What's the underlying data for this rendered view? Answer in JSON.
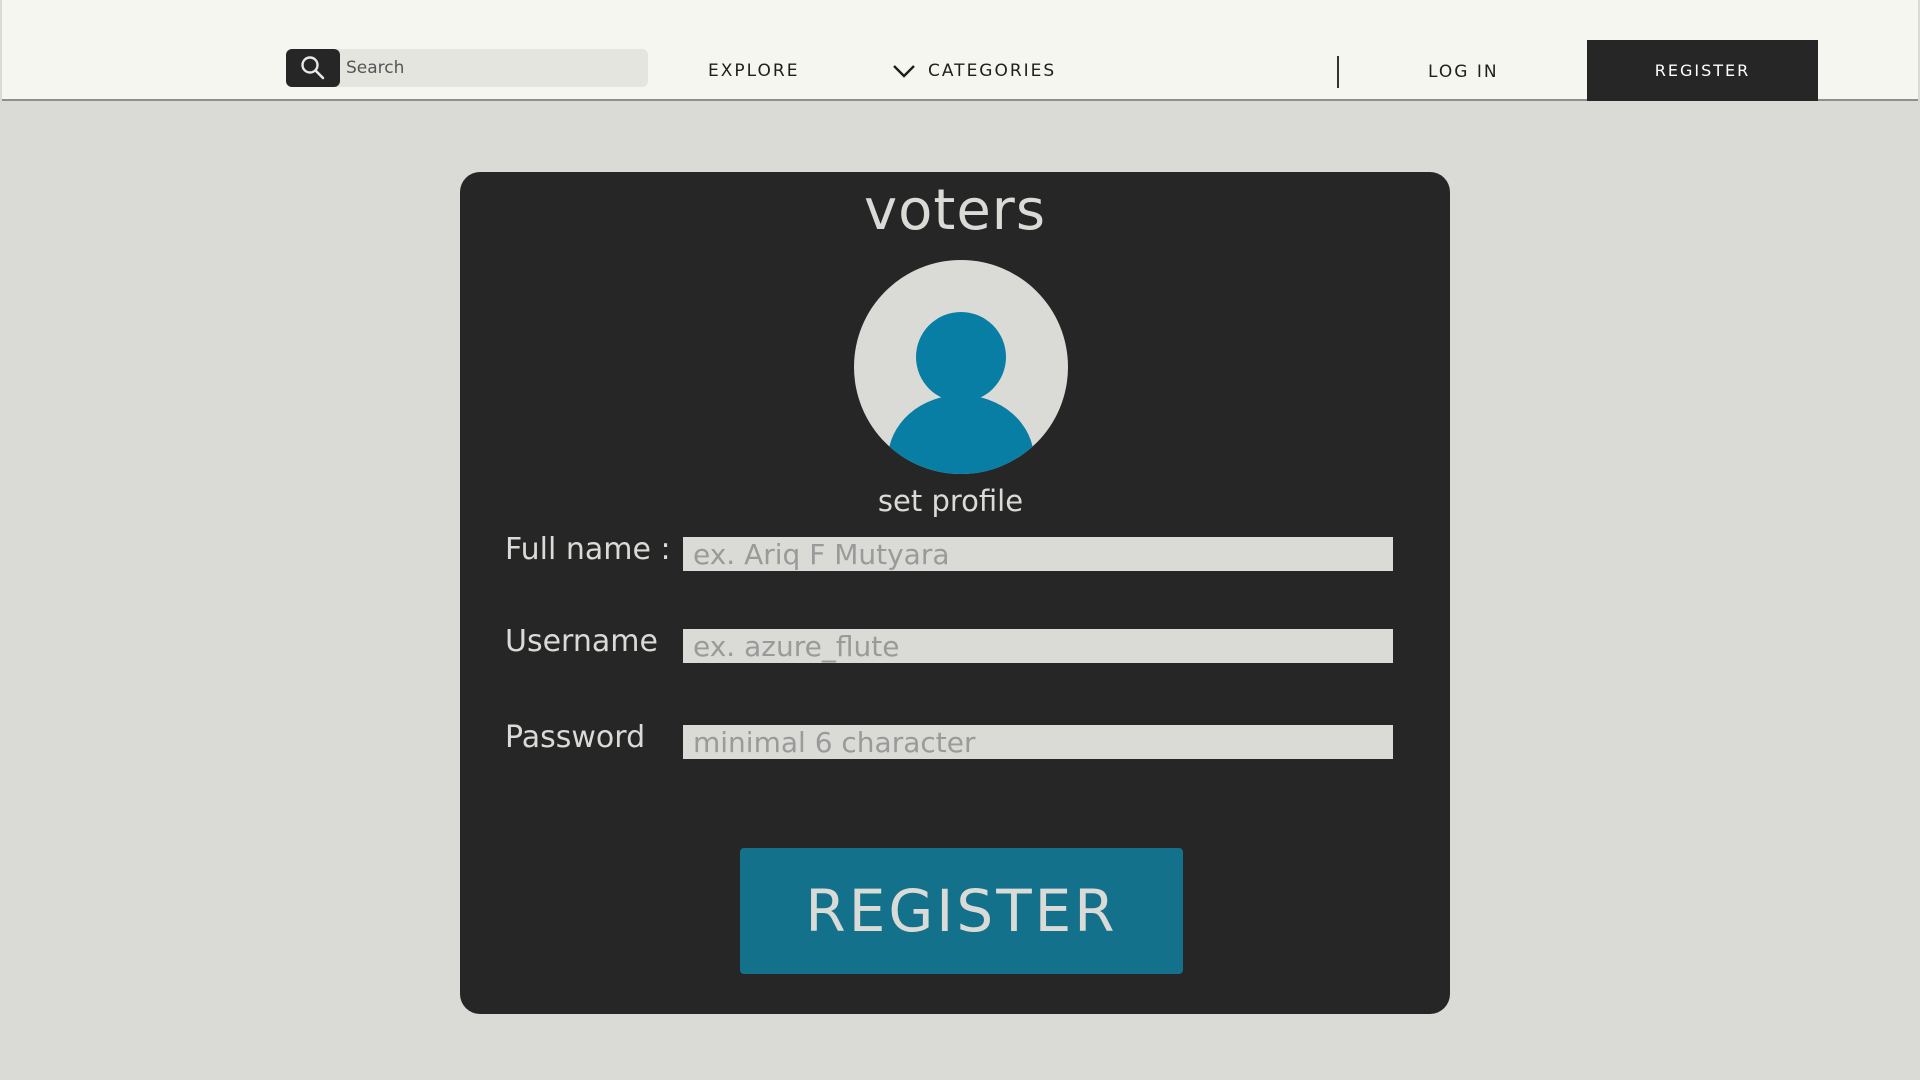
{
  "nav": {
    "search_placeholder": "Search",
    "explore_label": "EXPLORE",
    "categories_label": "CATEGORIES",
    "login_label": "LOG IN",
    "register_label": "REGISTER"
  },
  "card": {
    "title": "voters",
    "set_profile_label": "set profile",
    "fields": {
      "full_name": {
        "label": "Full name :",
        "placeholder": "ex. Ariq F Mutyara",
        "value": ""
      },
      "username": {
        "label": "Username",
        "placeholder": "ex. azure_flute",
        "value": ""
      },
      "password": {
        "label": "Password",
        "placeholder": "minimal 6 character",
        "value": ""
      }
    },
    "register_button_label": "REGISTER"
  },
  "colors": {
    "page_bg": "#dadbd6",
    "topbar_bg": "#f5f6ef",
    "card_bg": "#262626",
    "accent": "#13718c",
    "avatar_figure": "#087ea4"
  },
  "icons": {
    "search": "search-icon",
    "categories": "chevron-down-icon",
    "avatar": "user-avatar-icon"
  }
}
